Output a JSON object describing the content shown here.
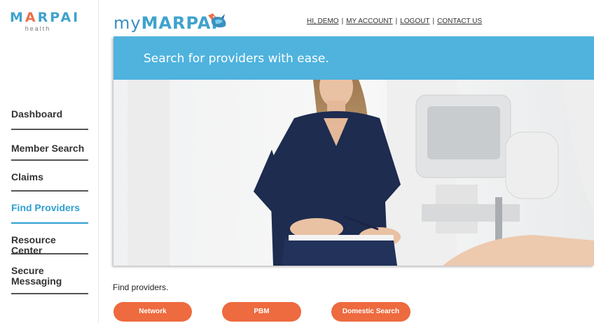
{
  "logo": {
    "main_left": "M",
    "main_accent": "A",
    "main_rest": "RPAI",
    "sub": "health"
  },
  "header": {
    "brand_prefix": "my",
    "brand_name": "MARPAI",
    "links": [
      "HI, DEMO",
      "MY ACCOUNT",
      "LOGOUT",
      "CONTACT US"
    ]
  },
  "sidebar": {
    "items": [
      {
        "label": "Dashboard",
        "active": false
      },
      {
        "label": "Member Search",
        "active": false
      },
      {
        "label": "Claims",
        "active": false
      },
      {
        "label": "Find Providers",
        "active": true
      },
      {
        "label": "Resource Center",
        "active": false
      },
      {
        "label_line1": "Secure",
        "label_line2": "Messaging",
        "active": false
      }
    ]
  },
  "hero": {
    "tagline": "Search for providers with ease."
  },
  "find": {
    "label": "Find providers.",
    "buttons": [
      "Network",
      "PBM",
      "Domestic Search"
    ]
  },
  "colors": {
    "brand_blue": "#4fb3de",
    "active_blue": "#2f9fd0",
    "button_orange": "#ee6a3f"
  }
}
